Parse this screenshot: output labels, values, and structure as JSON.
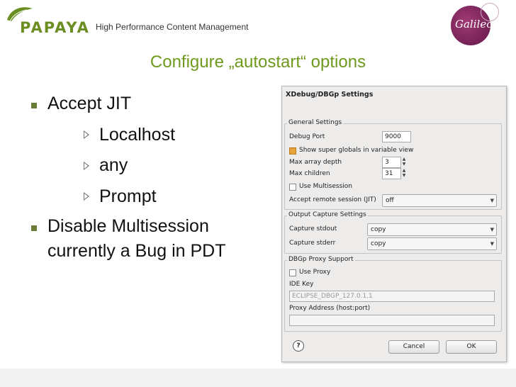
{
  "header": {
    "logo_text": "PAPAYA",
    "tagline": "High Performance Content Management",
    "badge_text": "Galileo"
  },
  "slide": {
    "title": "Configure „autostart“ options",
    "bullets": [
      {
        "text": "Accept JIT",
        "sub": [
          "Localhost",
          "any",
          "Prompt"
        ]
      },
      {
        "text_line1": "Disable Multisession",
        "text_line2": "currently a Bug in PDT"
      }
    ]
  },
  "dialog": {
    "title": "XDebug/DBGp Settings",
    "general": {
      "label": "General Settings",
      "debug_port_label": "Debug Port",
      "debug_port_value": "9000",
      "show_globals_label": "Show super globals in variable view",
      "show_globals_checked": true,
      "max_depth_label": "Max array depth",
      "max_depth_value": "3",
      "max_children_label": "Max children",
      "max_children_value": "31",
      "multisession_label": "Use Multisession",
      "multisession_checked": false,
      "accept_remote_label": "Accept remote session (JIT)",
      "accept_remote_value": "off"
    },
    "output": {
      "label": "Output Capture Settings",
      "stdout_label": "Capture stdout",
      "stdout_value": "copy",
      "stderr_label": "Capture stderr",
      "stderr_value": "copy"
    },
    "proxy": {
      "label": "DBGp Proxy Support",
      "use_proxy_label": "Use Proxy",
      "use_proxy_checked": false,
      "ide_key_label": "IDE Key",
      "ide_key_value": "ECLIPSE_DBGP_127.0.1.1",
      "proxy_address_label": "Proxy Address (host:port)",
      "proxy_address_value": ""
    },
    "help_glyph": "?",
    "cancel_label": "Cancel",
    "ok_label": "OK"
  },
  "colors": {
    "title_green": "#6f9a1e",
    "brand_green": "#6b8e23",
    "badge_purple": "#7a2058",
    "check_orange": "#e8a33d"
  }
}
